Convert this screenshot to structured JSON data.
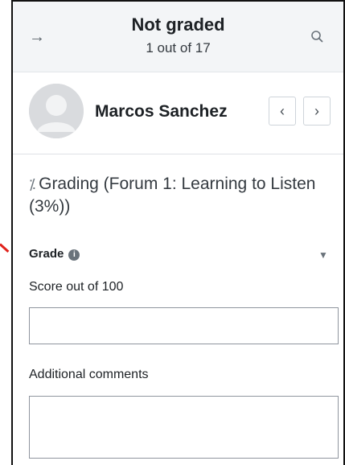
{
  "header": {
    "expand_icon": "arrow-right-icon",
    "title": "Not graded",
    "subtitle": "1 out of 17",
    "search_icon": "search-icon"
  },
  "user": {
    "name": "Marcos Sanchez",
    "prev_icon": "chevron-left-icon",
    "next_icon": "chevron-right-icon"
  },
  "grading": {
    "heading": "Grading (Forum 1: Learning to Listen (3%))",
    "grade_label": "Grade",
    "score_label": "Score out of 100",
    "score_value": "",
    "comments_label": "Additional comments",
    "comments_value": ""
  },
  "colors": {
    "header_bg": "#f3f5f7",
    "annotation": "#e0211b"
  }
}
